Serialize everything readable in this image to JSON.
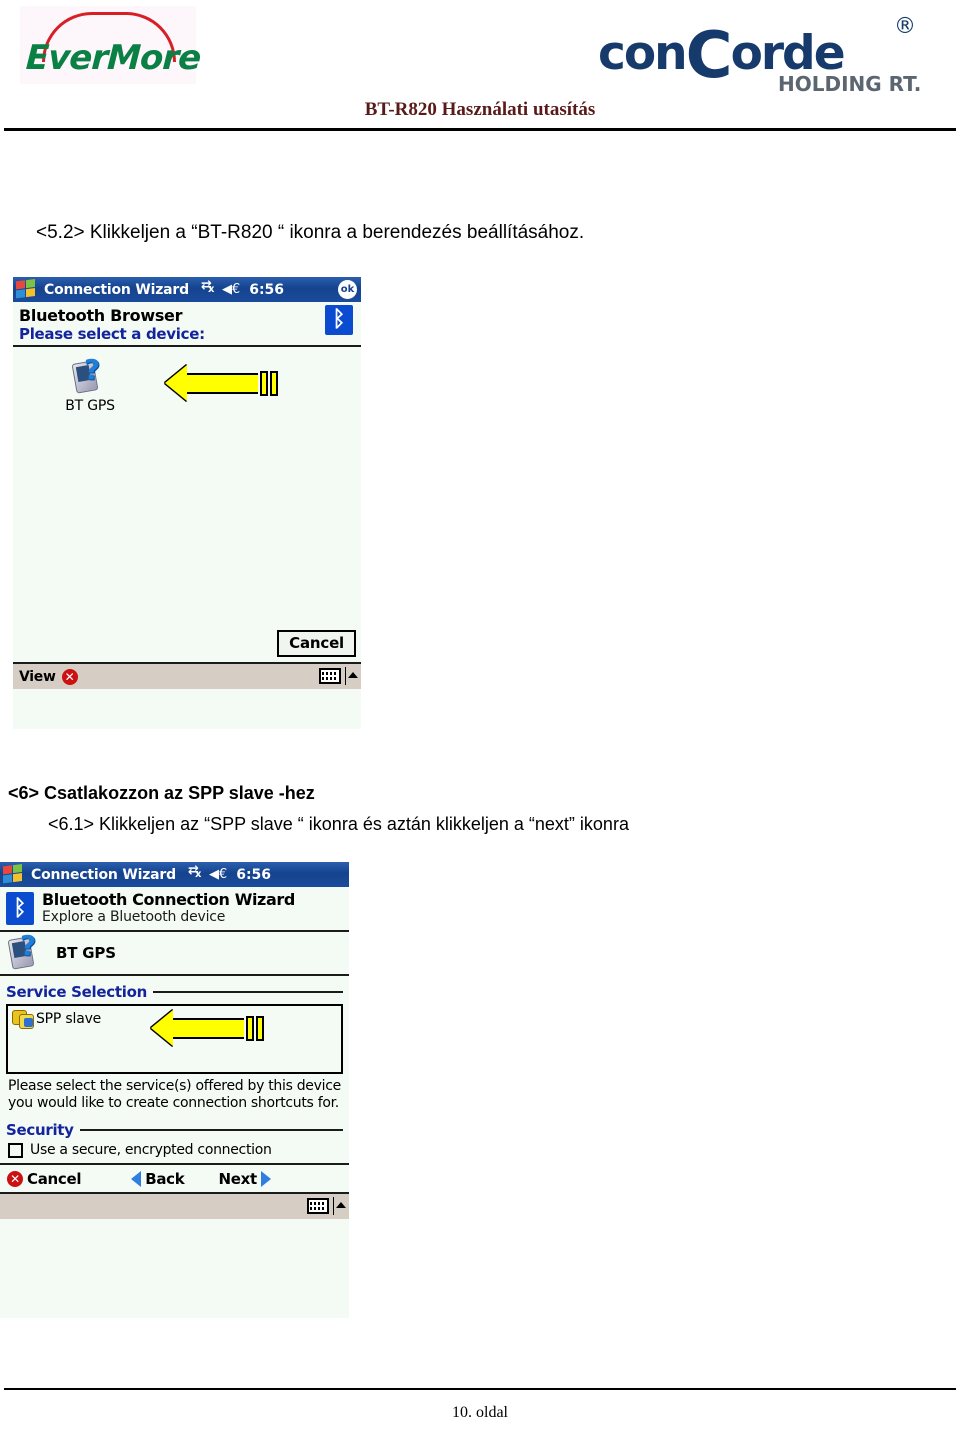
{
  "header": {
    "evermore_logo_text": "EverMore",
    "concorde_logo_text_part1": "con",
    "concorde_logo_text_big": "C",
    "concorde_logo_text_part2": "orde",
    "concorde_sub": "HOLDING RT.",
    "concorde_reg": "®",
    "doc_title": "BT-R820 Használati utasítás"
  },
  "body": {
    "step_5_2": "<5.2> Klikkeljen a “BT-R820 “ ikonra a berendezés beállításához.",
    "step_6": "<6> Csatlakozzon az SPP slave -hez",
    "step_6_1": "<6.1> Klikkeljen az “SPP slave “ ikonra és aztán klikkeljen a “next” ikonra"
  },
  "footer": {
    "page_label": "10. oldal"
  },
  "screenshot_1": {
    "titlebar": {
      "title": "Connection Wizard",
      "time": "6:56",
      "ok_label": "ok"
    },
    "heading": "Bluetooth Browser",
    "subheading": "Please select a device:",
    "device": {
      "label": "BT GPS"
    },
    "cancel_button": "Cancel",
    "taskbar": {
      "view_label": "View"
    }
  },
  "screenshot_2": {
    "titlebar": {
      "title": "Connection Wizard",
      "time": "6:56"
    },
    "heading": "Bluetooth Connection Wizard",
    "subheading": "Explore a Bluetooth device",
    "device": {
      "label": "BT GPS"
    },
    "service_group_title": "Service Selection",
    "service_item": "SPP slave",
    "help_text": "Please select the service(s) offered by this device you would like to create connection shortcuts for.",
    "security_group_title": "Security",
    "security_checkbox_label": "Use a secure, encrypted connection",
    "nav": {
      "cancel": "Cancel",
      "back": "Back",
      "next": "Next"
    }
  },
  "colors": {
    "title_red": "#5a1a1a",
    "evermore_green": "#0a8045",
    "evermore_red": "#d81f26",
    "concorde_navy": "#153a6b",
    "concorde_gray": "#5c6670",
    "titlebar_blue": "#15438e",
    "heading_blue": "#13249c",
    "annotation_yellow": "#ffff00",
    "taskbar_tan": "#d6cec4",
    "pda_bg": "#f4faf4"
  }
}
